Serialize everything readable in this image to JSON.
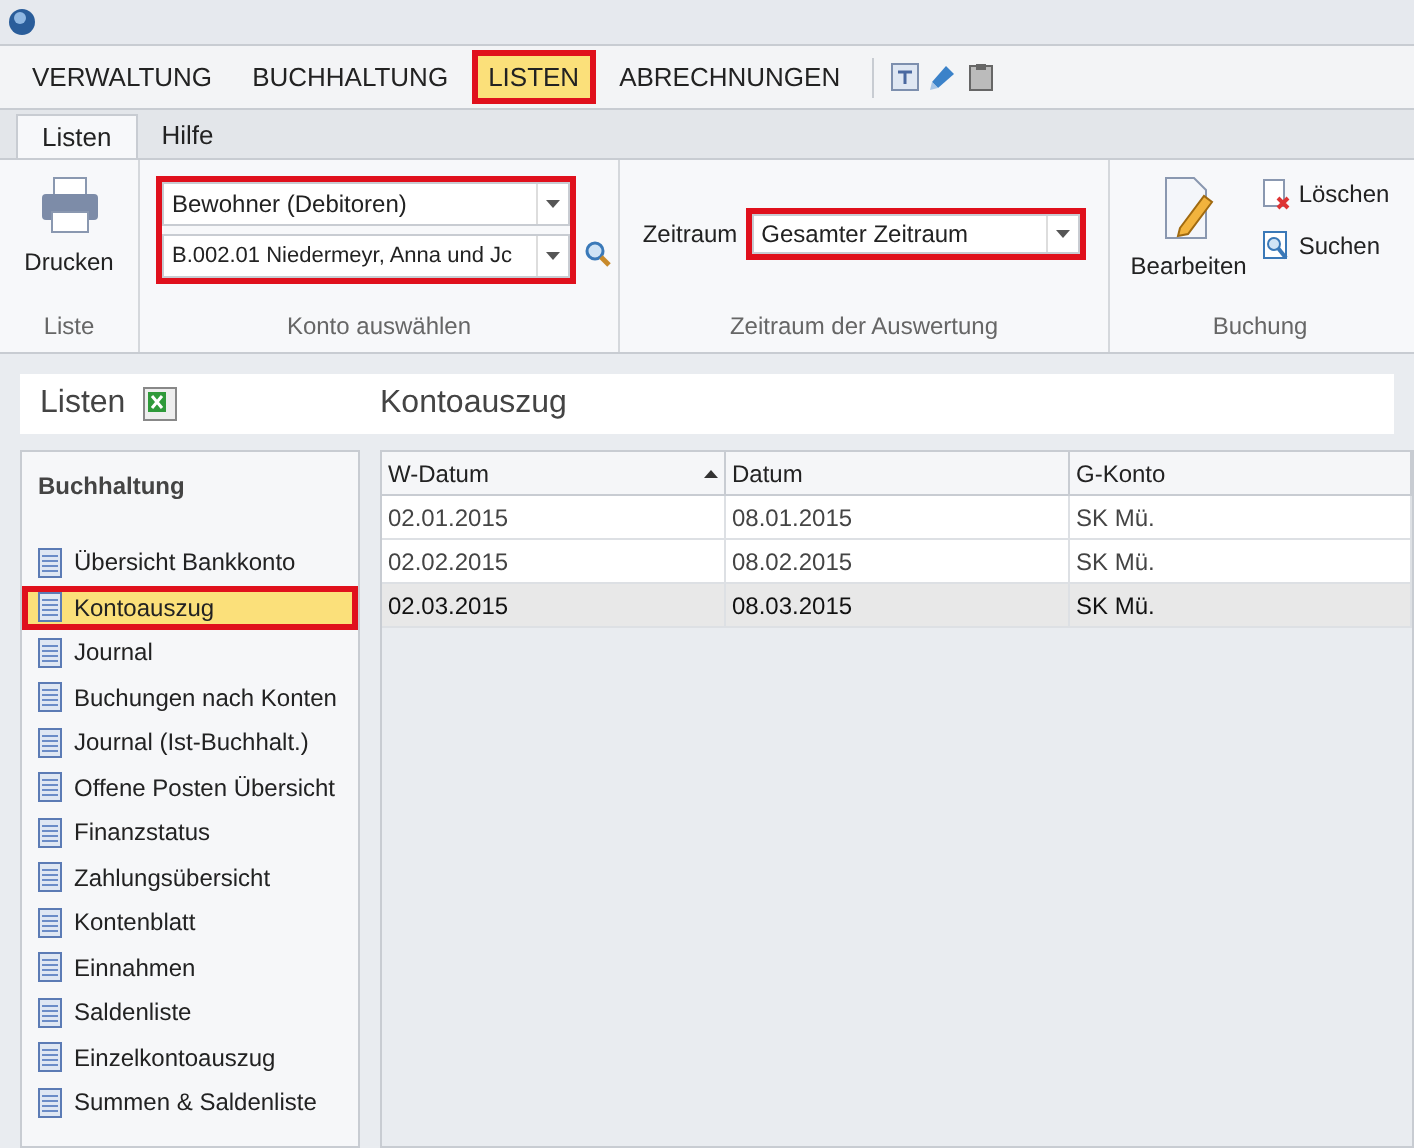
{
  "menu": [
    {
      "label": "VERWALTUNG",
      "selected": false,
      "highlighted": false
    },
    {
      "label": "BUCHHALTUNG",
      "selected": false,
      "highlighted": false
    },
    {
      "label": "LISTEN",
      "selected": true,
      "highlighted": true
    },
    {
      "label": "ABRECHNUNGEN",
      "selected": false,
      "highlighted": false
    }
  ],
  "ribbon_tabs": [
    {
      "label": "Listen",
      "selected": true
    },
    {
      "label": "Hilfe",
      "selected": false
    }
  ],
  "ribbon": {
    "liste": {
      "button": "Drucken",
      "caption": "Liste"
    },
    "konto": {
      "highlighted": true,
      "type_value": "Bewohner (Debitoren)",
      "account_value": "B.002.01 Niedermeyr, Anna und Jc",
      "caption": "Konto auswählen"
    },
    "zeitraum": {
      "label": "Zeitraum",
      "value": "Gesamter Zeitraum",
      "highlighted": true,
      "caption": "Zeitraum der Auswertung"
    },
    "buchung": {
      "edit": "Bearbeiten",
      "delete": "Löschen",
      "search": "Suchen",
      "caption": "Buchung"
    }
  },
  "header": {
    "title": "Listen",
    "content_title": "Kontoauszug"
  },
  "sidebar": {
    "title": "Buchhaltung",
    "items": [
      {
        "label": "Übersicht Bankkonto",
        "selected": false,
        "highlighted": false
      },
      {
        "label": "Kontoauszug",
        "selected": true,
        "highlighted": true
      },
      {
        "label": "Journal",
        "selected": false,
        "highlighted": false
      },
      {
        "label": "Buchungen nach Konten",
        "selected": false,
        "highlighted": false
      },
      {
        "label": "Journal (Ist-Buchhalt.)",
        "selected": false,
        "highlighted": false
      },
      {
        "label": "Offene Posten Übersicht",
        "selected": false,
        "highlighted": false
      },
      {
        "label": "Finanzstatus",
        "selected": false,
        "highlighted": false
      },
      {
        "label": "Zahlungsübersicht",
        "selected": false,
        "highlighted": false
      },
      {
        "label": "Kontenblatt",
        "selected": false,
        "highlighted": false
      },
      {
        "label": "Einnahmen",
        "selected": false,
        "highlighted": false
      },
      {
        "label": "Saldenliste",
        "selected": false,
        "highlighted": false
      },
      {
        "label": "Einzelkontoauszug",
        "selected": false,
        "highlighted": false
      },
      {
        "label": "Summen & Saldenliste",
        "selected": false,
        "highlighted": false
      }
    ]
  },
  "table": {
    "columns": [
      {
        "label": "W-Datum",
        "sorted": true
      },
      {
        "label": "Datum",
        "sorted": false
      },
      {
        "label": "G-Konto",
        "sorted": false
      }
    ],
    "rows": [
      {
        "cells": [
          "02.01.2015",
          "08.01.2015",
          "SK Mü."
        ],
        "selected": false
      },
      {
        "cells": [
          "02.02.2015",
          "08.02.2015",
          "SK Mü."
        ],
        "selected": false
      },
      {
        "cells": [
          "02.03.2015",
          "08.03.2015",
          "SK Mü."
        ],
        "selected": true
      }
    ]
  }
}
